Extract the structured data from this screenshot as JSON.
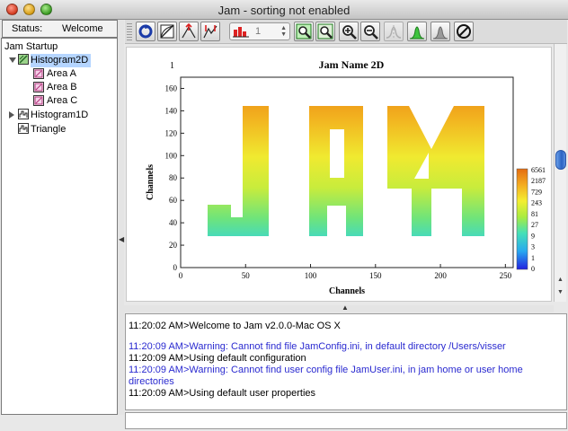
{
  "window": {
    "title": "Jam - sorting not enabled"
  },
  "status": {
    "label": "Status:",
    "value": "Welcome"
  },
  "tree": {
    "root": "Jam Startup",
    "nodes": [
      {
        "label": "Histogram2D",
        "expanded": true,
        "selected": true,
        "children": [
          "Area A",
          "Area B",
          "Area C"
        ]
      },
      {
        "label": "Histogram1D",
        "expanded": false
      },
      {
        "label": "Triangle"
      }
    ]
  },
  "toolbar": {
    "buttons": [
      "refresh-icon",
      "linear-log-icon",
      "autoscale-icon",
      "range-icon",
      "goto-icon",
      "zoom-region-icon",
      "zoom-fit-icon",
      "zoom-in-icon",
      "zoom-out-icon",
      "peak-find-icon",
      "gate-icon",
      "histogram-icon",
      "cancel-icon"
    ],
    "group_value": "1"
  },
  "plot": {
    "title": "Jam Name 2D",
    "corner": "1"
  },
  "chart_data": {
    "type": "heatmap",
    "title": "Jam Name 2D",
    "xlabel": "Channels",
    "ylabel": "Channels",
    "xlim": [
      0,
      256
    ],
    "ylim": [
      0,
      170
    ],
    "xticks": [
      0,
      50,
      100,
      150,
      200,
      250
    ],
    "yticks": [
      0,
      20,
      40,
      60,
      80,
      100,
      120,
      140,
      160
    ],
    "colorbar_ticks": [
      "0",
      "1",
      "3",
      "9",
      "27",
      "81",
      "243",
      "729",
      "2187",
      "6561"
    ],
    "colors": {
      "low": "#3a3ae8",
      "mid": "#f0f032",
      "high": "#e87a10"
    }
  },
  "console": {
    "lines": [
      {
        "text": "11:20:02 AM>Welcome to Jam v2.0.0-Mac OS X",
        "kind": "info"
      },
      {
        "text": "11:20:09 AM>Warning: Cannot find file JamConfig.ini, in default directory /Users/visser",
        "kind": "warn"
      },
      {
        "text": "11:20:09 AM>Using default configuration",
        "kind": "info"
      },
      {
        "text": "11:20:09 AM>Warning: Cannot find user config file JamUser.ini, in jam home or user home",
        "kind": "warn"
      },
      {
        "text": "directories",
        "kind": "warn"
      },
      {
        "text": "11:20:09 AM>Using default user properties",
        "kind": "info"
      }
    ]
  }
}
